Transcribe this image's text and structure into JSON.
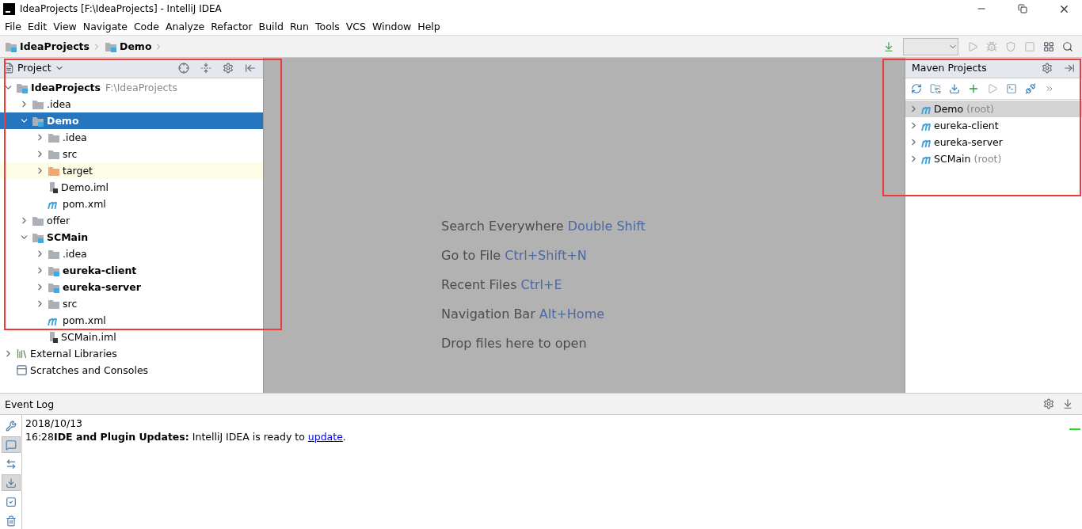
{
  "window": {
    "title": "IdeaProjects [F:\\IdeaProjects] - IntelliJ IDEA"
  },
  "menu": [
    "File",
    "Edit",
    "View",
    "Navigate",
    "Code",
    "Analyze",
    "Refactor",
    "Build",
    "Run",
    "Tools",
    "VCS",
    "Window",
    "Help"
  ],
  "breadcrumbs": [
    {
      "label": "IdeaProjects"
    },
    {
      "label": "Demo"
    }
  ],
  "project_panel": {
    "title": "Project",
    "highlighted": true,
    "tree": [
      {
        "label": "IdeaProjects",
        "hint": "F:\\IdeaProjects",
        "kind": "module",
        "bold": true,
        "expanded": true,
        "selected": false,
        "children": [
          {
            "label": ".idea",
            "kind": "folder",
            "bold": false,
            "expanded": false,
            "selected": false
          },
          {
            "label": "Demo",
            "kind": "module",
            "bold": true,
            "expanded": true,
            "selected": true,
            "children": [
              {
                "label": ".idea",
                "kind": "folder",
                "bold": false,
                "expanded": false,
                "selected": false
              },
              {
                "label": "src",
                "kind": "folder",
                "bold": false,
                "expanded": false,
                "selected": false
              },
              {
                "label": "target",
                "kind": "excluded",
                "bold": false,
                "expanded": false,
                "selected": false
              },
              {
                "label": "Demo.iml",
                "kind": "iml",
                "bold": false,
                "selected": false
              },
              {
                "label": "pom.xml",
                "kind": "maven",
                "bold": false,
                "selected": false
              }
            ]
          },
          {
            "label": "offer",
            "kind": "folder",
            "bold": false,
            "expanded": false,
            "selected": false
          },
          {
            "label": "SCMain",
            "kind": "module",
            "bold": true,
            "expanded": true,
            "selected": false,
            "children": [
              {
                "label": ".idea",
                "kind": "folder",
                "bold": false,
                "expanded": false,
                "selected": false
              },
              {
                "label": "eureka-client",
                "kind": "module",
                "bold": true,
                "expanded": false,
                "selected": false
              },
              {
                "label": "eureka-server",
                "kind": "module",
                "bold": true,
                "expanded": false,
                "selected": false
              },
              {
                "label": "src",
                "kind": "folder",
                "bold": false,
                "expanded": false,
                "selected": false
              },
              {
                "label": "pom.xml",
                "kind": "maven",
                "bold": false,
                "selected": false
              },
              {
                "label": "SCMain.iml",
                "kind": "iml",
                "bold": false,
                "selected": false
              }
            ]
          }
        ]
      },
      {
        "label": "External Libraries",
        "kind": "libraries",
        "bold": false,
        "expanded": false,
        "selected": false
      },
      {
        "label": "Scratches and Consoles",
        "kind": "scratches",
        "bold": false,
        "selected": false
      }
    ]
  },
  "editor_hints": [
    {
      "text": "Search Everywhere",
      "shortcut": "Double Shift"
    },
    {
      "text": "Go to File",
      "shortcut": "Ctrl+Shift+N"
    },
    {
      "text": "Recent Files",
      "shortcut": "Ctrl+E"
    },
    {
      "text": "Navigation Bar",
      "shortcut": "Alt+Home"
    },
    {
      "text": "Drop files here to open"
    }
  ],
  "maven_panel": {
    "title": "Maven Projects",
    "highlighted": true,
    "projects": [
      {
        "label": "Demo",
        "hint": "(root)",
        "selected": true
      },
      {
        "label": "eureka-client",
        "selected": false
      },
      {
        "label": "eureka-server",
        "selected": false
      },
      {
        "label": "SCMain",
        "hint": "(root)",
        "selected": false
      }
    ]
  },
  "event_log": {
    "title": "Event Log",
    "tools": [
      {
        "on": false
      },
      {
        "on": true
      },
      {
        "on": false
      },
      {
        "on": true
      },
      {
        "on": false
      },
      {
        "on": false
      }
    ],
    "date": "2018/10/13",
    "message": "16:28**IDE and Plugin Updates:** IntelliJ IDEA is ready to ",
    "link": "update",
    "suffix": "."
  }
}
